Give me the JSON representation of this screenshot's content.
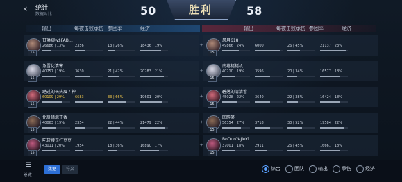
{
  "header": {
    "back_glyph": "‹",
    "title": "统计",
    "subtitle": "数据对比",
    "score_left": "50",
    "score_right": "58",
    "result": "胜利"
  },
  "columns": {
    "output": "输出",
    "taken": "每被击败承伤",
    "participation": "参团率",
    "economy": "经济"
  },
  "left_team": [
    {
      "name": "甘琳脚w$FAB…",
      "level": "15",
      "output": "26686 | 13%",
      "taken": "2356",
      "part": "13 | 26%",
      "eco": "18436 | 19%",
      "out_pct": 0.13,
      "taken_pct": 0.35,
      "part_pct": 0.26,
      "eco_pct": 0.19
    },
    {
      "name": "急雪化清寒",
      "level": "15",
      "output": "40757 | 19%",
      "taken": "3630",
      "part": "21 | 42%",
      "eco": "20283 | 21%",
      "out_pct": 0.19,
      "taken_pct": 0.55,
      "part_pct": 0.42,
      "eco_pct": 0.21
    },
    {
      "name": "踏过的长头眉 / 神",
      "level": "15",
      "output": "60109 | 29%",
      "taken": "6683",
      "part": "33 | 66%",
      "eco": "19601 | 20%",
      "out_pct": 0.29,
      "taken_pct": 1.0,
      "part_pct": 0.66,
      "eco_pct": 0.2
    },
    {
      "name": "化身猎塘丁香",
      "level": "15",
      "output": "40063 | 19%",
      "taken": "2354",
      "part": "22 | 44%",
      "eco": "21479 | 22%",
      "out_pct": 0.19,
      "taken_pct": 0.35,
      "part_pct": 0.44,
      "eco_pct": 0.22
    },
    {
      "name": "吃斩腰丧打豆豆",
      "level": "15",
      "output": "43011 | 20%",
      "taken": "1954",
      "part": "18 | 36%",
      "eco": "16890 | 17%",
      "out_pct": 0.2,
      "taken_pct": 0.29,
      "part_pct": 0.36,
      "eco_pct": 0.17
    }
  ],
  "left_highlight": {
    "output_row": 2,
    "taken_row": 2,
    "part_row": 2
  },
  "right_team": [
    {
      "name": "风月618",
      "level": "15",
      "output": "49866 | 24%",
      "taken": "6000",
      "part": "26 | 45%",
      "eco": "21137 | 23%",
      "out_pct": 0.24,
      "taken_pct": 0.9,
      "part_pct": 0.45,
      "eco_pct": 0.23
    },
    {
      "name": "南巷猪猪机",
      "level": "15",
      "output": "40210 | 19%",
      "taken": "3596",
      "part": "20 | 34%",
      "eco": "16577 | 18%",
      "out_pct": 0.19,
      "taken_pct": 0.54,
      "part_pct": 0.34,
      "eco_pct": 0.18
    },
    {
      "name": "碧落的清清看",
      "level": "15",
      "output": "45028 | 22%",
      "taken": "3640",
      "part": "22 | 38%",
      "eco": "16424 | 18%",
      "out_pct": 0.22,
      "taken_pct": 0.55,
      "part_pct": 0.38,
      "eco_pct": 0.18
    },
    {
      "name": "回眸笑",
      "level": "15",
      "output": "56354 | 27%",
      "taken": "3718",
      "part": "30 | 52%",
      "eco": "19584 | 22%",
      "out_pct": 0.27,
      "taken_pct": 0.56,
      "part_pct": 0.52,
      "eco_pct": 0.22
    },
    {
      "name": "BoDuoYeJieYi",
      "level": "15",
      "output": "37001 | 18%",
      "taken": "2911",
      "part": "26 | 45%",
      "eco": "16661 | 18%",
      "out_pct": 0.18,
      "taken_pct": 0.44,
      "part_pct": 0.45,
      "eco_pct": 0.18
    }
  ],
  "bottom": {
    "overview_icon": "☰",
    "overview_label": "总览",
    "tabs": [
      "数据",
      "符文"
    ],
    "filters": [
      "综合",
      "团队",
      "输出",
      "承伤",
      "经济"
    ]
  },
  "colors": {
    "highlight": "#f2c94c",
    "blue": "#2d6fd6",
    "red": "#b42840"
  }
}
